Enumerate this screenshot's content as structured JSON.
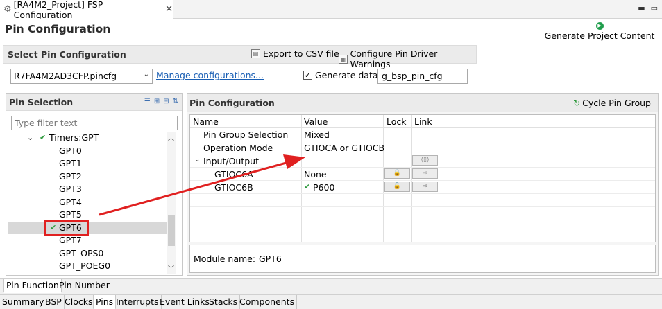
{
  "editor_tab": {
    "title": "[RA4M2_Project] FSP Configuration"
  },
  "page": {
    "title": "Pin Configuration"
  },
  "toolbar": {
    "generate_label": "Generate Project Content"
  },
  "select_section": {
    "title": "Select Pin Configuration",
    "export_label": "Export to CSV file",
    "warnings_label": "Configure Pin Driver Warnings",
    "config_file": "R7FA4M2AD3CFP.pincfg",
    "manage_link": "Manage configurations...",
    "generate_data_label": "Generate data:",
    "generate_data_checked": true,
    "generate_data_value": "g_bsp_pin_cfg"
  },
  "pin_selection": {
    "title": "Pin Selection",
    "filter_placeholder": "Type filter text",
    "tree": [
      {
        "label": "Timers:GPT",
        "expanded": true,
        "checked": true,
        "group": true
      },
      {
        "label": "GPT0"
      },
      {
        "label": "GPT1"
      },
      {
        "label": "GPT2"
      },
      {
        "label": "GPT3"
      },
      {
        "label": "GPT4"
      },
      {
        "label": "GPT5"
      },
      {
        "label": "GPT6",
        "checked": true,
        "selected": true
      },
      {
        "label": "GPT7"
      },
      {
        "label": "GPT_OPS0"
      },
      {
        "label": "GPT_POEG0"
      }
    ]
  },
  "pin_config": {
    "title": "Pin Configuration",
    "cycle_label": "Cycle Pin Group",
    "columns": [
      "Name",
      "Value",
      "Lock",
      "Link"
    ],
    "rows": [
      {
        "name": "Pin Group Selection",
        "value": "Mixed"
      },
      {
        "name": "Operation Mode",
        "value": "GTIOCA or GTIOCB"
      },
      {
        "name": "Input/Output",
        "value": ""
      },
      {
        "name": "GTIOC6A",
        "value": "None"
      },
      {
        "name": "GTIOC6B",
        "value": "P600"
      }
    ],
    "module_label": "Module name:",
    "module_value": "GPT6"
  },
  "sub_tabs": [
    "Pin Function",
    "Pin Number"
  ],
  "bottom_tabs": [
    "Summary",
    "BSP",
    "Clocks",
    "Pins",
    "Interrupts",
    "Event Links",
    "Stacks",
    "Components"
  ],
  "active_bottom_tab": "Pins",
  "annotation_color": "#e02020"
}
